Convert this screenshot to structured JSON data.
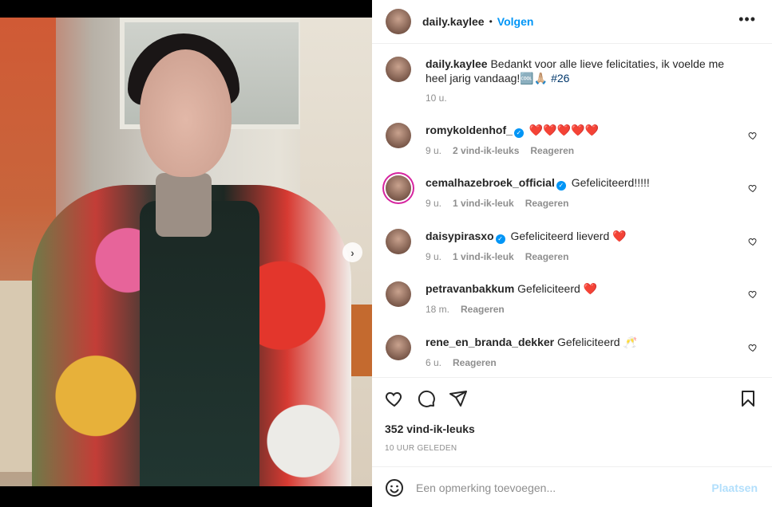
{
  "post": {
    "author": "daily.kaylee",
    "follow_label": "Volgen",
    "more_label": "•••",
    "caption": {
      "user": "daily.kaylee",
      "text": "Bedankt voor alle lieve felicitaties, ik voelde me heel jarig vandaag!🆒🙏🏼",
      "hashtag": "#26",
      "time": "10 u."
    },
    "likes": "352 vind-ik-leuks",
    "posted": "10 UUR GELEDEN"
  },
  "comments": [
    {
      "user": "romykoldenhof_",
      "verified": true,
      "text": "❤️❤️❤️❤️❤️",
      "time": "9 u.",
      "likes": "2 vind-ik-leuks",
      "reply": "Reageren"
    },
    {
      "user": "cemalhazebroek_official",
      "verified": true,
      "text": "Gefeliciteerd!!!!!",
      "time": "9 u.",
      "likes": "1 vind-ik-leuk",
      "reply": "Reageren"
    },
    {
      "user": "daisypirasxo",
      "verified": true,
      "text": "Gefeliciteerd lieverd ❤️",
      "time": "9 u.",
      "likes": "1 vind-ik-leuk",
      "reply": "Reageren"
    },
    {
      "user": "petravanbakkum",
      "verified": false,
      "text": "Gefeliciteerd ❤️",
      "time": "18 m.",
      "likes": "",
      "reply": "Reageren"
    },
    {
      "user": "rene_en_branda_dekker",
      "verified": false,
      "text": "Gefeliciteerd 🥂",
      "time": "6 u.",
      "likes": "",
      "reply": "Reageren"
    }
  ],
  "composer": {
    "placeholder": "Een opmerking toevoegen...",
    "post_label": "Plaatsen"
  },
  "icons": {
    "like": "heart-icon",
    "comment": "comment-icon",
    "share": "share-icon",
    "save": "bookmark-icon",
    "emoji": "emoji-icon",
    "next": "chevron-right-icon"
  },
  "colors": {
    "accent": "#0095f6",
    "verified": "#0095f6",
    "post_button_disabled": "#b2dffc"
  }
}
